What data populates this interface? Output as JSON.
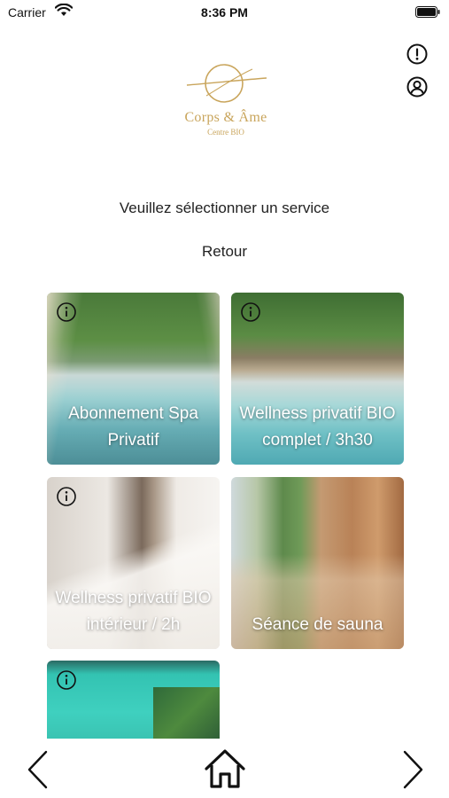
{
  "status_bar": {
    "carrier": "Carrier",
    "time": "8:36 PM"
  },
  "brand": {
    "name": "Corps & Âme",
    "subtitle": "Centre BIO",
    "color": "#c9a55c"
  },
  "header_icons": [
    "alert-circle-icon",
    "account-circle-icon"
  ],
  "instruction": "Veuillez sélectionner un service",
  "back_label": "Retour",
  "services": [
    {
      "label": "Abonnement Spa Privatif",
      "icon": "info-icon"
    },
    {
      "label": "Wellness privatif BIO complet / 3h30",
      "icon": "info-icon"
    },
    {
      "label": "Wellness privatif BIO intérieur / 2h",
      "icon": "info-icon"
    },
    {
      "label": "Séance de sauna",
      "icon": "info-icon"
    },
    {
      "label": "",
      "icon": "info-icon"
    }
  ],
  "bottom_nav": [
    "chevron-left-icon",
    "home-icon",
    "chevron-right-icon"
  ]
}
